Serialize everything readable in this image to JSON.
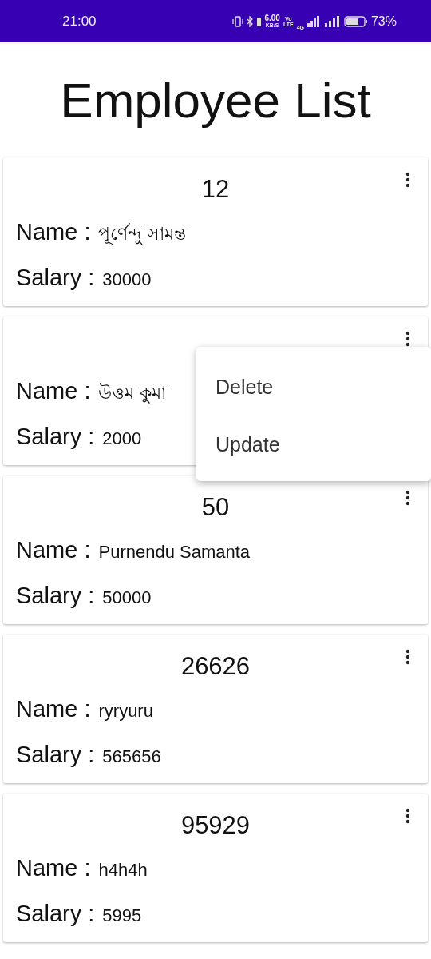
{
  "status_bar": {
    "time": "21:00",
    "speed_value": "6.00",
    "speed_unit": "KB/S",
    "volte_top": "Vo",
    "volte_bottom": "LTE",
    "network": "4G",
    "battery_text": "73%"
  },
  "title": "Employee List",
  "employees": [
    {
      "id": "12",
      "name_label": "Name :",
      "name": "পূর্ণেন্দু সামন্ত",
      "salary_label": "Salary :",
      "salary": "30000",
      "menu_open": false
    },
    {
      "name_label": "Name :",
      "name": "উত্তম কুমা",
      "salary_label": "Salary :",
      "salary": "2000",
      "menu_open": true
    },
    {
      "id": "50",
      "name_label": "Name :",
      "name": "Purnendu Samanta",
      "salary_label": "Salary :",
      "salary": "50000",
      "menu_open": false
    },
    {
      "id": "26626",
      "name_label": "Name :",
      "name": "ryryuru",
      "salary_label": "Salary :",
      "salary": "565656",
      "menu_open": false
    },
    {
      "id": "95929",
      "name_label": "Name :",
      "name": "h4h4h",
      "salary_label": "Salary :",
      "salary": "5995",
      "menu_open": false
    }
  ],
  "menu": {
    "items": [
      "Delete",
      "Update"
    ]
  }
}
